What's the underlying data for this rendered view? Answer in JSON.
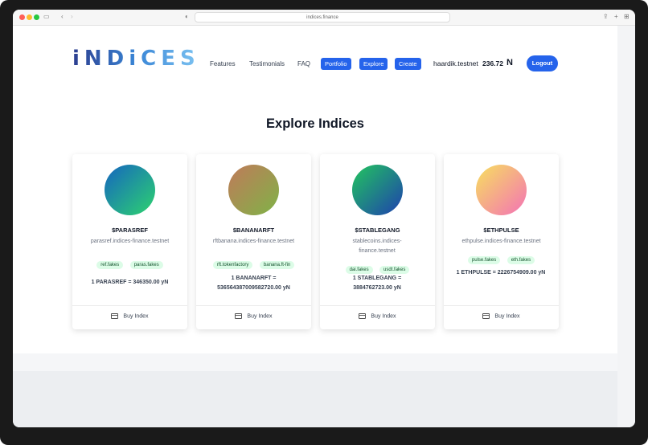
{
  "browser": {
    "url": "indices.finance"
  },
  "header": {
    "logo": "iNDiCES",
    "nav": [
      "Features",
      "Testimonials",
      "FAQ"
    ],
    "buttons": [
      "Portfolio",
      "Explore",
      "Create"
    ],
    "user": "haardik.testnet",
    "balance": "236.72",
    "currency_symbol": "N",
    "logout_label": "Logout"
  },
  "main": {
    "title": "Explore Indices",
    "cards": [
      {
        "symbol": "$PARASREF",
        "address": "parasref.indices-finance.testnet",
        "tags": [
          "ref.fakes",
          "paras.fakes"
        ],
        "price": "1 PARASREF = 346350.00 yN",
        "buy_label": "Buy Index",
        "gradient": [
          "#1565c0",
          "#2dd36f"
        ]
      },
      {
        "symbol": "$BANANARFT",
        "address": "rftbanana.indices-finance.testnet",
        "tags": [
          "rft.tokenfactory",
          "banana.ft-fin"
        ],
        "price": "1 BANANARFT = 536564387009582720.00 yN",
        "buy_label": "Buy Index",
        "gradient": [
          "#c07a5a",
          "#7fb347"
        ]
      },
      {
        "symbol": "$STABLEGANG",
        "address": "stablecoins.indices-finance.testnet",
        "tags": [
          "dai.fakes",
          "usdt.fakes"
        ],
        "price": "1 STABLEGANG = 3884762723.00 yN",
        "buy_label": "Buy Index",
        "gradient": [
          "#22c55e",
          "#1e40af"
        ]
      },
      {
        "symbol": "$ETHPULSE",
        "address": "ethpulse.indices-finance.testnet",
        "tags": [
          "pulse.fakes",
          "eth.fakes"
        ],
        "price": "1 ETHPULSE = 2226754909.00 yN",
        "buy_label": "Buy Index",
        "gradient": [
          "#f6e05e",
          "#f472b6"
        ]
      }
    ]
  }
}
